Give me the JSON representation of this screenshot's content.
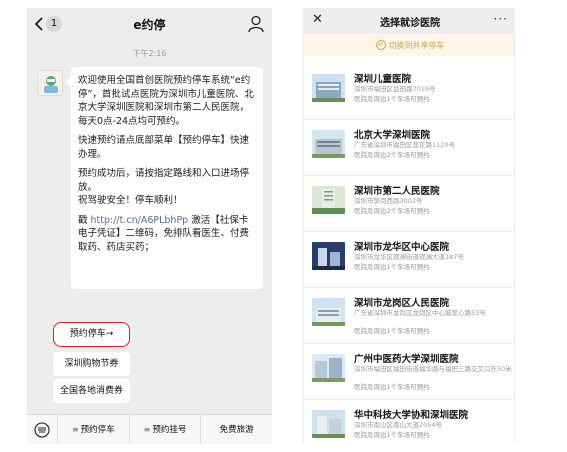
{
  "left": {
    "badge_count": "1",
    "title": "e约停",
    "timestamp": "下午2:16",
    "message": {
      "para1": "欢迎使用全国首创医院预约停车系统“e约停”，首批试点医院为深圳市儿童医院、北京大学深圳医院和深圳市第二人民医院，每天0点-24点均可预约。",
      "para2": "快速预约请点底部菜单【预约停车】快速办理。",
      "para3": "预约成功后，请按指定路线和入口进场停放。",
      "para4": "祝驾驶安全！停车顺利！",
      "para5_prefix": "戳 ",
      "para5_link": "http://t.cn/A6PLbhPp",
      "para5_suffix": " 激活【社保卡电子凭证】二维码，免排队看医生、付费取药、药店买药；"
    },
    "menu": {
      "primary": "预约停车→",
      "second": "深圳购物节券",
      "third": "全国各地消费券"
    },
    "bottom_bar": [
      "预约停车",
      "预约挂号",
      "免费旅游"
    ]
  },
  "right": {
    "title": "选择就诊医院",
    "switch_label": "切换到共享停车",
    "hospitals": [
      {
        "name": "深圳儿童医院",
        "address": "深圳市福田区益田路7019号",
        "note": "医院及周边1个车场可预约"
      },
      {
        "name": "北京大学深圳医院",
        "address": "广东省深圳市福田区莲花路1120号",
        "note": "医院及周边2个车场可预约"
      },
      {
        "name": "深圳市第二人民医院",
        "address": "深圳市笋岗西路3002号",
        "note": "医院及周边2个车场可预约"
      },
      {
        "name": "深圳市龙华区中心医院",
        "address": "深圳市龙华区观澜街道观澜大道187号",
        "note": "医院及周边1个车场可预约"
      },
      {
        "name": "深圳市龙岗区人民医院",
        "address": "广东省深圳市龙岗区龙岗区中心城爱心路53号",
        "note": "医院及周边1个车场可预约"
      },
      {
        "name": "广州中医药大学深圳医院",
        "address": "深圳市福田区福田街道福华路与福田三路交叉口东50米",
        "note": "医院及周边1个车场可预约"
      },
      {
        "name": "华中科技大学协和深圳医院",
        "address": "深圳市南山区南山大道2054号",
        "note": "医院及周边1个车场可预约"
      }
    ]
  }
}
